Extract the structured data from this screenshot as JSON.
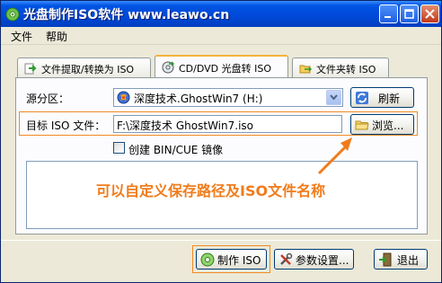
{
  "window": {
    "title": "光盘制作ISO软件 www.leawo.cn"
  },
  "menu": [
    "文件",
    "帮助"
  ],
  "tabs": [
    {
      "label": "文件提取/转换为 ISO",
      "active": false
    },
    {
      "label": "CD/DVD 光盘转 ISO",
      "active": true
    },
    {
      "label": "文件夹转 ISO",
      "active": false
    }
  ],
  "source": {
    "label": "源分区：",
    "selected": "深度技术.GhostWin7 (H:)",
    "refresh_label": "刷新"
  },
  "target": {
    "label": "目标 ISO 文件：",
    "value": "F:\\深度技术 GhostWin7.iso",
    "browse_label": "浏览..."
  },
  "bin_cue": {
    "label": "创建 BIN/CUE 镜像",
    "checked": false
  },
  "annotation": {
    "text": "可以自定义保存路径及ISO文件名称",
    "color": "#f07c1c"
  },
  "buttons": {
    "make_iso": "制作 ISO",
    "settings": "参数设置...",
    "exit": "退出"
  },
  "colors": {
    "titlebar": "#0054e3",
    "highlight": "#f08a24",
    "tab_active_border": "#f3b33d"
  }
}
